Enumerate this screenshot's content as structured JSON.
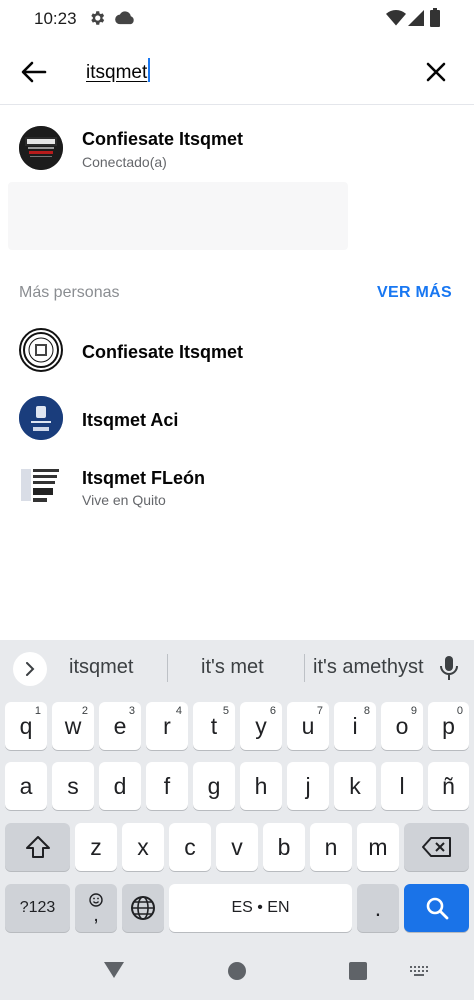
{
  "status_bar": {
    "time": "10:23",
    "icons": [
      "gear-icon",
      "cloud-icon",
      "wifi-icon",
      "signal-icon",
      "battery-icon"
    ]
  },
  "search": {
    "query": "itsqmet",
    "back_icon": "back-arrow-icon",
    "clear_icon": "close-icon"
  },
  "top_result": {
    "name": "Confiesate Itsqmet",
    "subtitle": "Conectado(a)"
  },
  "more_people": {
    "title": "Más personas",
    "see_more": "VER MÁS",
    "items": [
      {
        "name": "Confiesate Itsqmet",
        "subtitle": ""
      },
      {
        "name": "Itsqmet Aci",
        "subtitle": ""
      },
      {
        "name": "Itsqmet FLeón",
        "subtitle": "Vive en Quito"
      }
    ]
  },
  "keyboard": {
    "suggestions": [
      "itsqmet",
      "it's met",
      "it's amethyst"
    ],
    "row1": [
      {
        "k": "q",
        "h": "1"
      },
      {
        "k": "w",
        "h": "2"
      },
      {
        "k": "e",
        "h": "3"
      },
      {
        "k": "r",
        "h": "4"
      },
      {
        "k": "t",
        "h": "5"
      },
      {
        "k": "y",
        "h": "6"
      },
      {
        "k": "u",
        "h": "7"
      },
      {
        "k": "i",
        "h": "8"
      },
      {
        "k": "o",
        "h": "9"
      },
      {
        "k": "p",
        "h": "0"
      }
    ],
    "row2": [
      "a",
      "s",
      "d",
      "f",
      "g",
      "h",
      "j",
      "k",
      "l",
      "ñ"
    ],
    "row3": [
      "z",
      "x",
      "c",
      "v",
      "b",
      "n",
      "m"
    ],
    "symbols_label": "?123",
    "emoji_comma": ",",
    "space_label": "ES • EN",
    "period": ".",
    "accent_color": "#1a73e8"
  },
  "colors": {
    "brand_blue": "#1877f2",
    "secondary_text": "#65676b"
  }
}
